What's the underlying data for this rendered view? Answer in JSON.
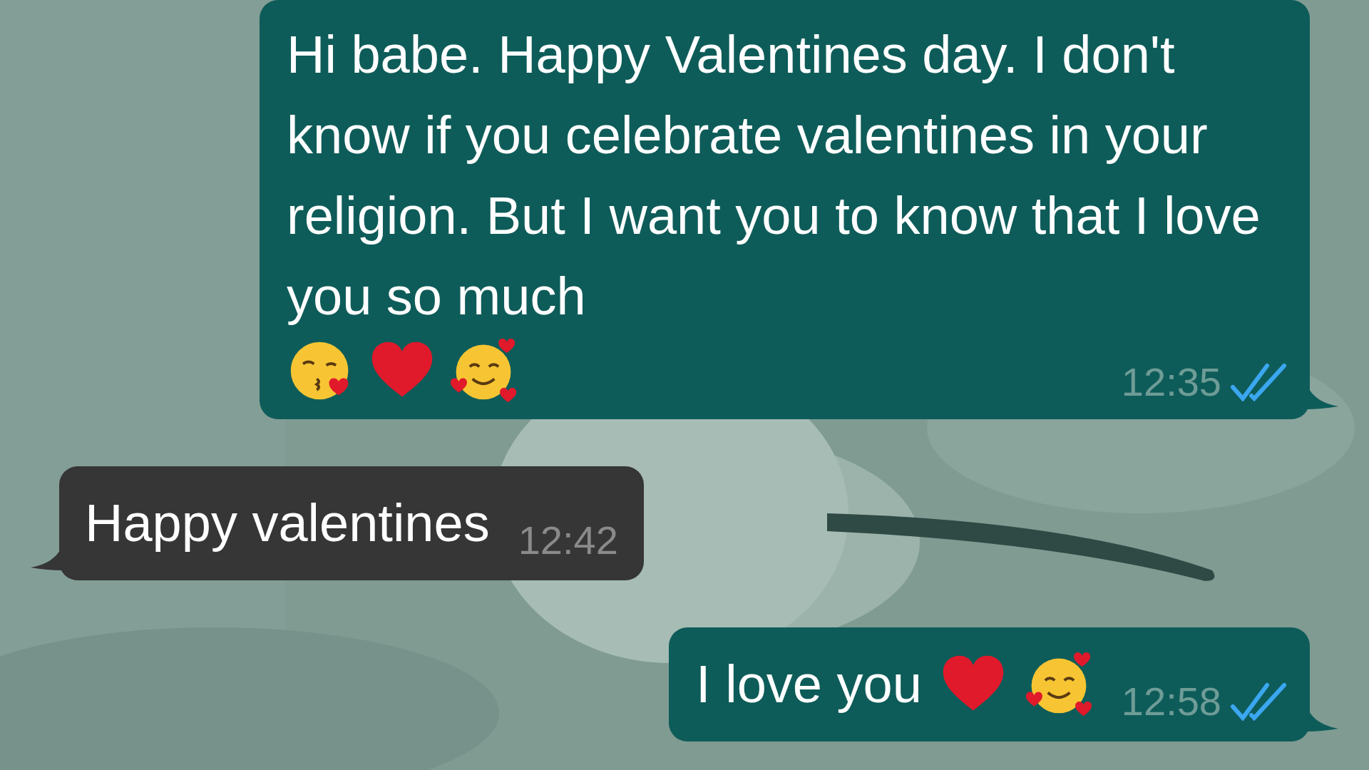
{
  "messages": [
    {
      "kind": "outgoing",
      "text": "Hi babe. Happy Valentines day. I don't know if you celebrate valentines in your religion. But I want you to know that I love you so much",
      "emojis": [
        {
          "kind": "kiss"
        },
        {
          "kind": "heart"
        },
        {
          "kind": "hearts-face"
        }
      ],
      "time": "12:35",
      "read": true
    },
    {
      "kind": "incoming",
      "text": "Happy valentines",
      "time": "12:42"
    },
    {
      "kind": "outgoing",
      "text": "I love you",
      "emojis": [
        {
          "kind": "heart"
        },
        {
          "kind": "hearts-face"
        }
      ],
      "time": "12:58",
      "read": true
    }
  ]
}
